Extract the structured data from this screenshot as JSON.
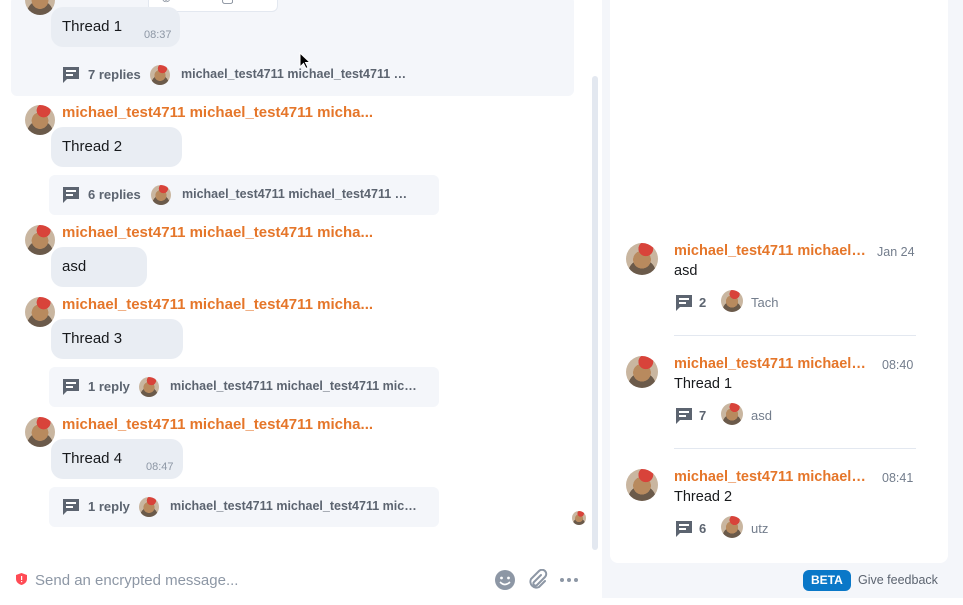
{
  "timeline": {
    "thread1": {
      "body": "Thread 1",
      "time": "08:37",
      "replies": "7 replies",
      "participants": "michael_test4711 michael_test4711 mi..."
    },
    "thread2": {
      "sender": "michael_test4711 michael_test4711 micha...",
      "body": "Thread 2",
      "replies": "6 replies",
      "participants": "michael_test4711 michael_test4711 mi..."
    },
    "asd": {
      "sender": "michael_test4711 michael_test4711 micha...",
      "body": "asd"
    },
    "thread3": {
      "sender": "michael_test4711 michael_test4711 micha...",
      "body": "Thread 3",
      "replies": "1 reply",
      "participants": "michael_test4711 michael_test4711 mich..."
    },
    "thread4": {
      "sender": "michael_test4711 michael_test4711 micha...",
      "body": "Thread 4",
      "time": "08:47",
      "replies": "1 reply",
      "participants": "michael_test4711 michael_test4711 mich..."
    }
  },
  "composer": {
    "placeholder": "Send an encrypted message..."
  },
  "threads_panel": {
    "items": [
      {
        "sender": "michael_test4711 michael_...",
        "time": "Jan 24",
        "body": "asd",
        "count": "2",
        "last_reply": "Tach"
      },
      {
        "sender": "michael_test4711 michael_t...",
        "time": "08:40",
        "body": "Thread 1",
        "count": "7",
        "last_reply": "asd"
      },
      {
        "sender": "michael_test4711 michael_t...",
        "time": "08:41",
        "body": "Thread 2",
        "count": "6",
        "last_reply": "utz"
      }
    ]
  },
  "footer": {
    "beta_label": "BETA",
    "feedback_label": "Give feedback"
  },
  "colors": {
    "sender": "#e5762a",
    "beta": "#0a78c8",
    "bubble": "#e9edf3",
    "thread_summary_bg": "#f4f6fa"
  }
}
